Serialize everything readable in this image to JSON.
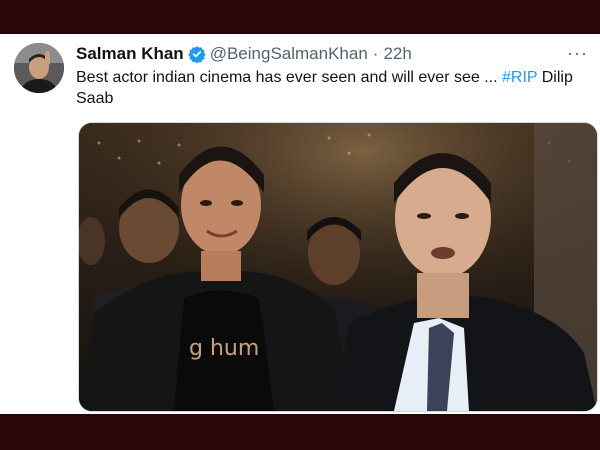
{
  "tweet": {
    "display_name": "Salman Khan",
    "handle": "@BeingSalmanKhan",
    "separator": "·",
    "time": "22h",
    "more_label": "···",
    "text_main": "Best actor indian cinema has ever seen and will ever see ... ",
    "hashtag": "#RIP",
    "text_after": " Dilip Saab",
    "photo": {
      "shirt_text": "g hum"
    }
  },
  "icons": {
    "verified": "verified-badge-icon",
    "more": "more-options-icon"
  },
  "colors": {
    "link": "#1d9bf0",
    "frame": "#2a0606",
    "name": "#0f1419",
    "secondary": "#536471"
  }
}
